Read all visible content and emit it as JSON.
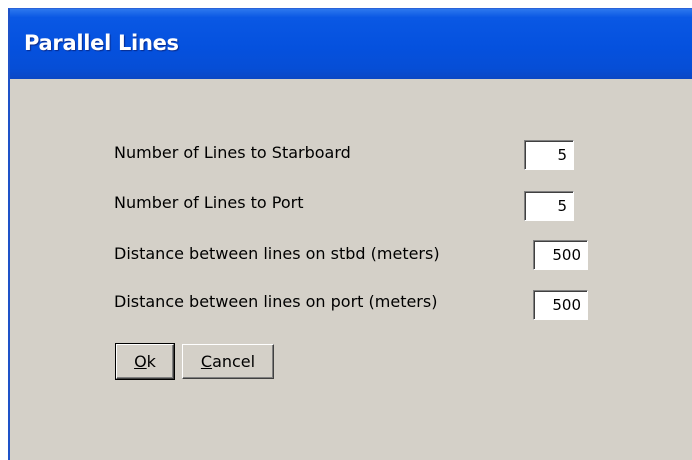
{
  "window": {
    "title": "Parallel Lines"
  },
  "form": {
    "rows": [
      {
        "label": "Number of Lines to Starboard",
        "value": "5"
      },
      {
        "label": "Number of Lines to Port",
        "value": "5"
      },
      {
        "label": "Distance between lines on stbd (meters)",
        "value": "500"
      },
      {
        "label": "Distance between lines on port (meters)",
        "value": "500"
      }
    ]
  },
  "buttons": {
    "ok": {
      "mnemonic": "O",
      "rest": "k"
    },
    "cancel": {
      "mnemonic": "C",
      "rest": "ancel"
    }
  }
}
